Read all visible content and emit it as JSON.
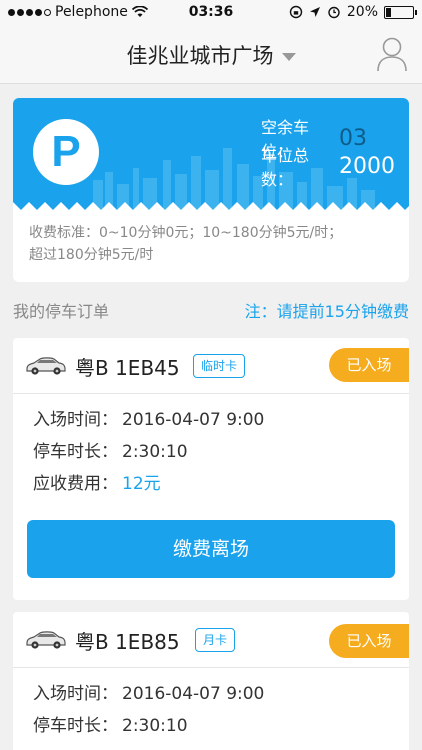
{
  "status_bar": {
    "carrier": "Pelephone",
    "time": "03:36",
    "battery": "20%",
    "battery_level": 0.2
  },
  "nav": {
    "title": "佳兆业城市广场"
  },
  "parking": {
    "logo_letter": "P",
    "free_label": "空余车位：",
    "free_value": "03",
    "total_label": "车位总数：",
    "total_value": "2000",
    "fee_line1": "收费标准：0~10分钟0元；10~180分钟5元/时；",
    "fee_line2": "超过180分钟5元/时"
  },
  "orders_section": {
    "title": "我的停车订单",
    "note": "注：请提前15分钟缴费"
  },
  "orders": [
    {
      "plate": "粤B 1EB45",
      "card_type": "临时卡",
      "status": "已入场",
      "entry_label": "入场时间：",
      "entry_value": "2016-04-07  9:00",
      "duration_label": "停车时长：",
      "duration_value": "2:30:10",
      "fee_label": "应收费用：",
      "fee_value": "12元",
      "pay_button": "缴费离场"
    },
    {
      "plate": "粤B 1EB85",
      "card_type": "月卡",
      "status": "已入场",
      "entry_label": "入场时间：",
      "entry_value": "2016-04-07  9:00",
      "duration_label": "停车时长：",
      "duration_value": "2:30:10"
    }
  ],
  "colors": {
    "accent": "#1aa3ec",
    "status_badge": "#f5ac1f"
  }
}
